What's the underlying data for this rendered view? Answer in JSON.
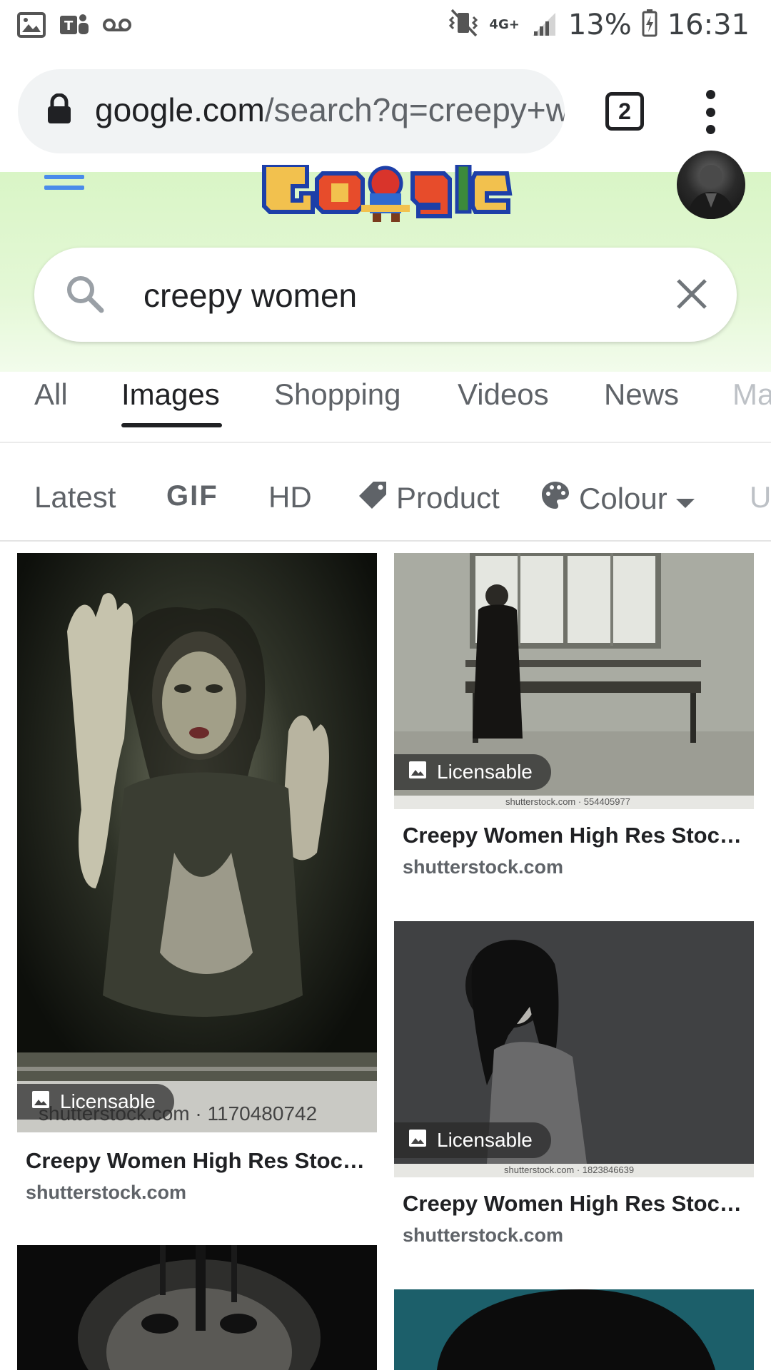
{
  "status_bar": {
    "network": "4G+",
    "battery": "13%",
    "time": "16:31"
  },
  "browser": {
    "url_domain": "google.com",
    "url_path": "/search?q=creepy+women",
    "tab_count": "2"
  },
  "search": {
    "query": "creepy women"
  },
  "tabs": [
    {
      "label": "All",
      "active": false
    },
    {
      "label": "Images",
      "active": true
    },
    {
      "label": "Shopping",
      "active": false
    },
    {
      "label": "Videos",
      "active": false
    },
    {
      "label": "News",
      "active": false
    },
    {
      "label": "Ma",
      "active": false
    }
  ],
  "chips": {
    "latest": "Latest",
    "gif": "GIF",
    "hd": "HD",
    "product": "Product",
    "colour": "Colour",
    "more": "U"
  },
  "results": [
    {
      "badge": "Licensable",
      "watermark": "shutterstock.com · 1170480742",
      "title": "Creepy Women High Res Stoc…",
      "source": "shutterstock.com"
    },
    {
      "badge": "Licensable",
      "watermark": "shutterstock.com · 554405977",
      "title": "Creepy Women High Res Stoc…",
      "source": "shutterstock.com"
    },
    {
      "badge": "Licensable",
      "watermark": "shutterstock.com · 1823846639",
      "title": "Creepy Women High Res Stoc…",
      "source": "shutterstock.com"
    }
  ],
  "colors": {
    "doodle_bg": "#d9f5c6",
    "hamburger": "#4a8bea",
    "text_primary": "#202124",
    "text_secondary": "#5f6368"
  }
}
